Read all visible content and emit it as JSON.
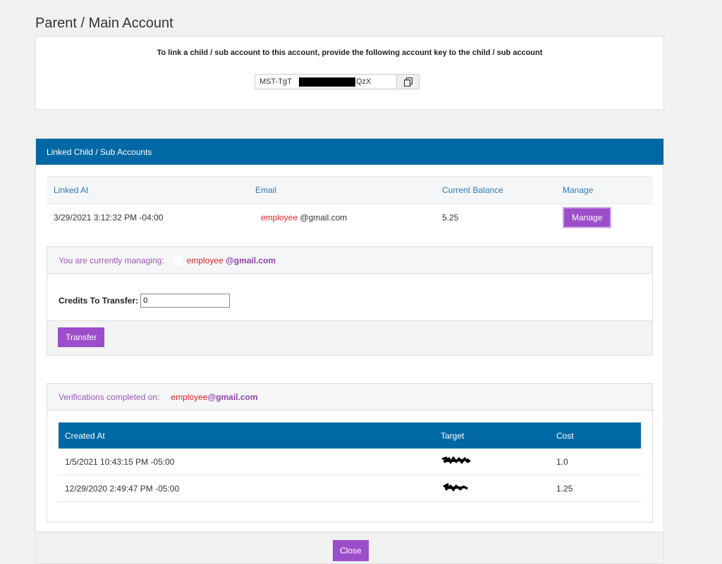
{
  "page": {
    "title": "Parent / Main Account"
  },
  "account_key": {
    "instructions": "To link a child / sub account to this account, provide the following account key to the child / sub account",
    "key_prefix": "MST-TgT",
    "key_suffix": "QzX",
    "copy_icon": "copy-icon"
  },
  "linked": {
    "header": "Linked Child / Sub Accounts",
    "columns": [
      "Linked At",
      "Email",
      "Current Balance",
      "Manage"
    ],
    "rows": [
      {
        "linked_at": "3/29/2021 3:12:32 PM -04:00",
        "email_user": "employee",
        "email_domain": "@gmail.com",
        "balance": "5.25",
        "manage_label": "Manage"
      }
    ]
  },
  "managing": {
    "prefix": "You are currently managing:",
    "email_user": "employee",
    "email_domain": "@gmail.com",
    "credits_label": "Credits To Transfer:",
    "credits_value": "0",
    "transfer_label": "Transfer"
  },
  "verifications": {
    "prefix": "Verifications completed on:",
    "email_user": "employee",
    "email_domain": "@gmail.com",
    "columns": [
      "Created At",
      "Target",
      "Cost"
    ],
    "rows": [
      {
        "created_at": "1/5/2021 10:43:15 PM -05:00",
        "cost": "1.0"
      },
      {
        "created_at": "12/29/2020 2:49:47 PM -05:00",
        "cost": "1.25"
      }
    ]
  },
  "footer": {
    "close_label": "Close"
  },
  "colors": {
    "header_blue": "#0068a5",
    "accent_purple": "#9b4dca",
    "red": "#e02424"
  }
}
